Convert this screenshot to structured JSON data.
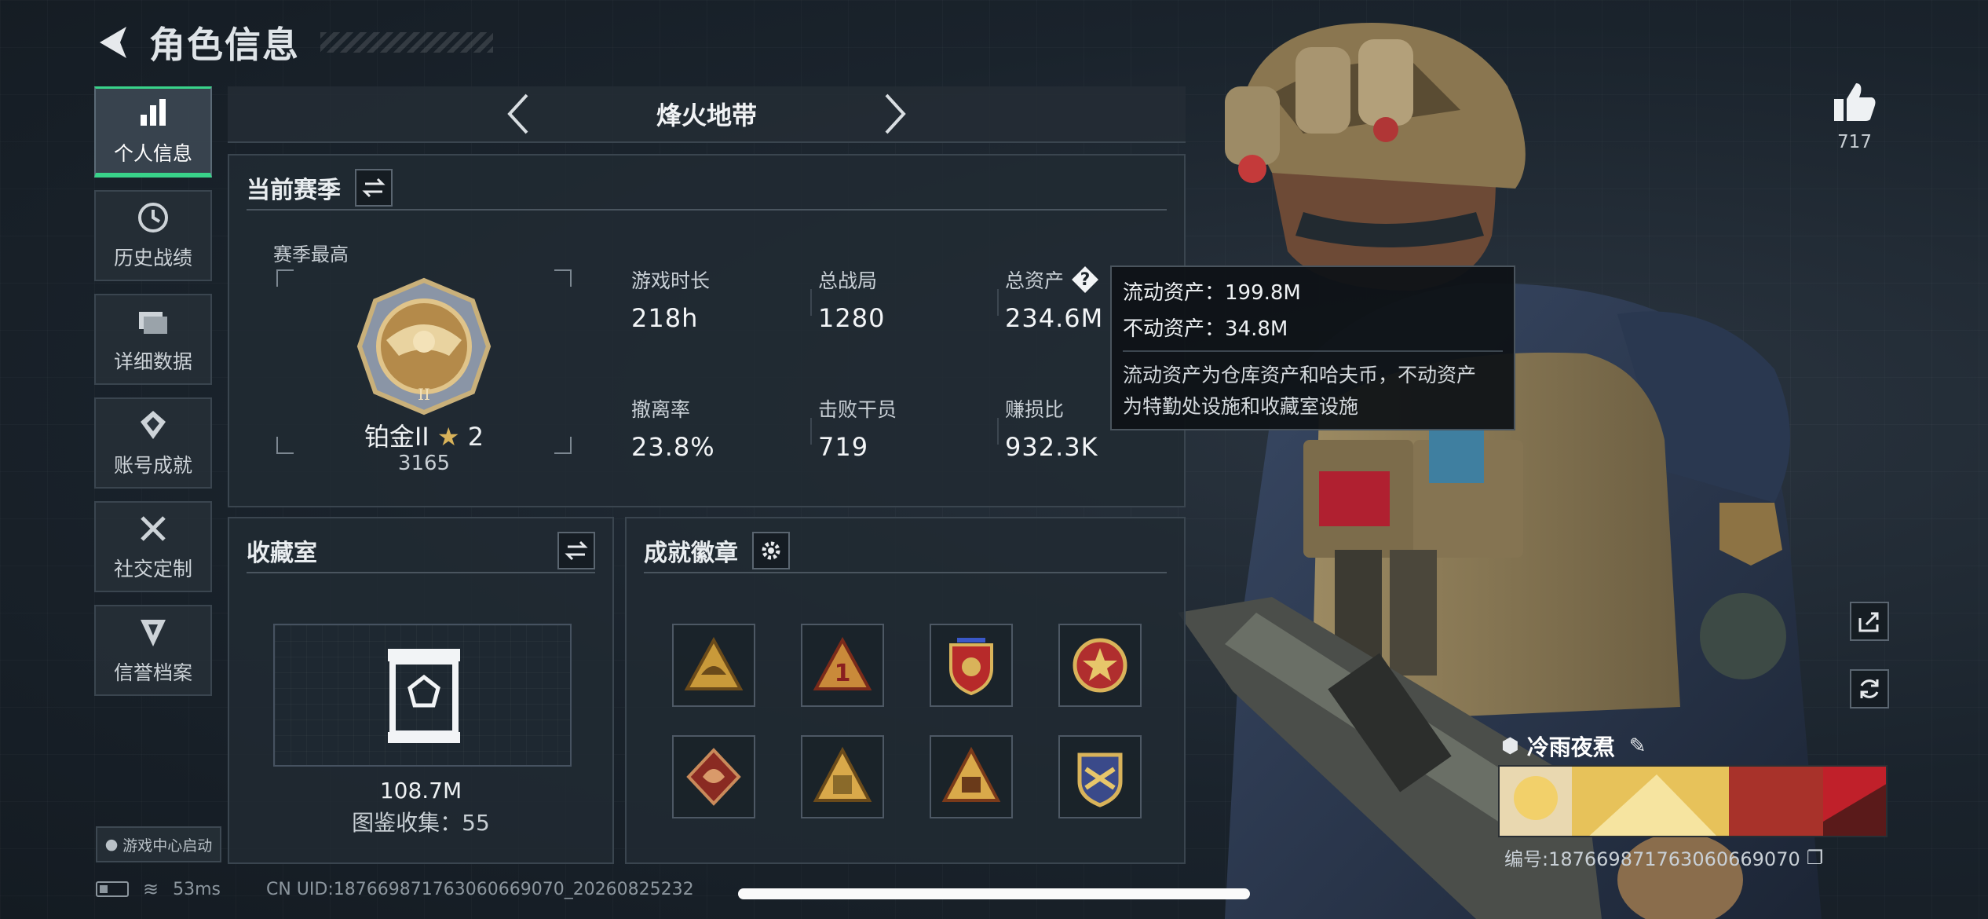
{
  "header": {
    "title": "角色信息"
  },
  "sidebar": {
    "items": [
      {
        "label": "个人信息",
        "icon": "bar-chart-icon",
        "active": true
      },
      {
        "label": "历史战绩",
        "icon": "clock-icon",
        "active": false
      },
      {
        "label": "详细数据",
        "icon": "folder-icon",
        "active": false
      },
      {
        "label": "账号成就",
        "icon": "achievement-icon",
        "active": false
      },
      {
        "label": "社交定制",
        "icon": "tools-icon",
        "active": false
      },
      {
        "label": "信誉档案",
        "icon": "shield-icon",
        "active": false
      }
    ],
    "launch_chip": "游戏中心启动"
  },
  "mode": {
    "name": "烽火地带"
  },
  "season": {
    "title": "当前赛季",
    "sub_label": "赛季最高",
    "rank_name": "铂金II",
    "rank_stars": "2",
    "rank_score": "3165",
    "stats": [
      {
        "label": "游戏时长",
        "value": "218h"
      },
      {
        "label": "总战局",
        "value": "1280"
      },
      {
        "label": "总资产",
        "value": "234.6M",
        "help": "?"
      },
      {
        "label": "撤离率",
        "value": "23.8%"
      },
      {
        "label": "击败干员",
        "value": "719"
      },
      {
        "label": "赚损比",
        "value": "932.3K"
      }
    ]
  },
  "tooltip": {
    "liquid": "流动资产：199.8M",
    "fixed": "不动资产：34.8M",
    "desc_line1": "流动资产为仓库资产和哈夫币，不动资产",
    "desc_line2": "为特勤处设施和收藏室设施"
  },
  "collection": {
    "title": "收藏室",
    "value": "108.7M",
    "count_text": "图鉴收集：55"
  },
  "badges": {
    "title": "成就徽章",
    "items": [
      "triangle-helmet-badge",
      "triangle-one-badge",
      "shield-star-badge",
      "round-star-badge",
      "dragon-badge",
      "triangle-gold-badge",
      "triangle-56-badge",
      "crest-badge"
    ]
  },
  "like": {
    "count": "717"
  },
  "player": {
    "name": "冷雨夜焄",
    "id_text": "编号:18766987176306066907​0"
  },
  "status": {
    "ping": "53ms",
    "uid": "CN UID:187669871763060669070_20260825232"
  },
  "colors": {
    "accent": "#39d38a",
    "background": "#17212a",
    "panel": "#212a32"
  }
}
